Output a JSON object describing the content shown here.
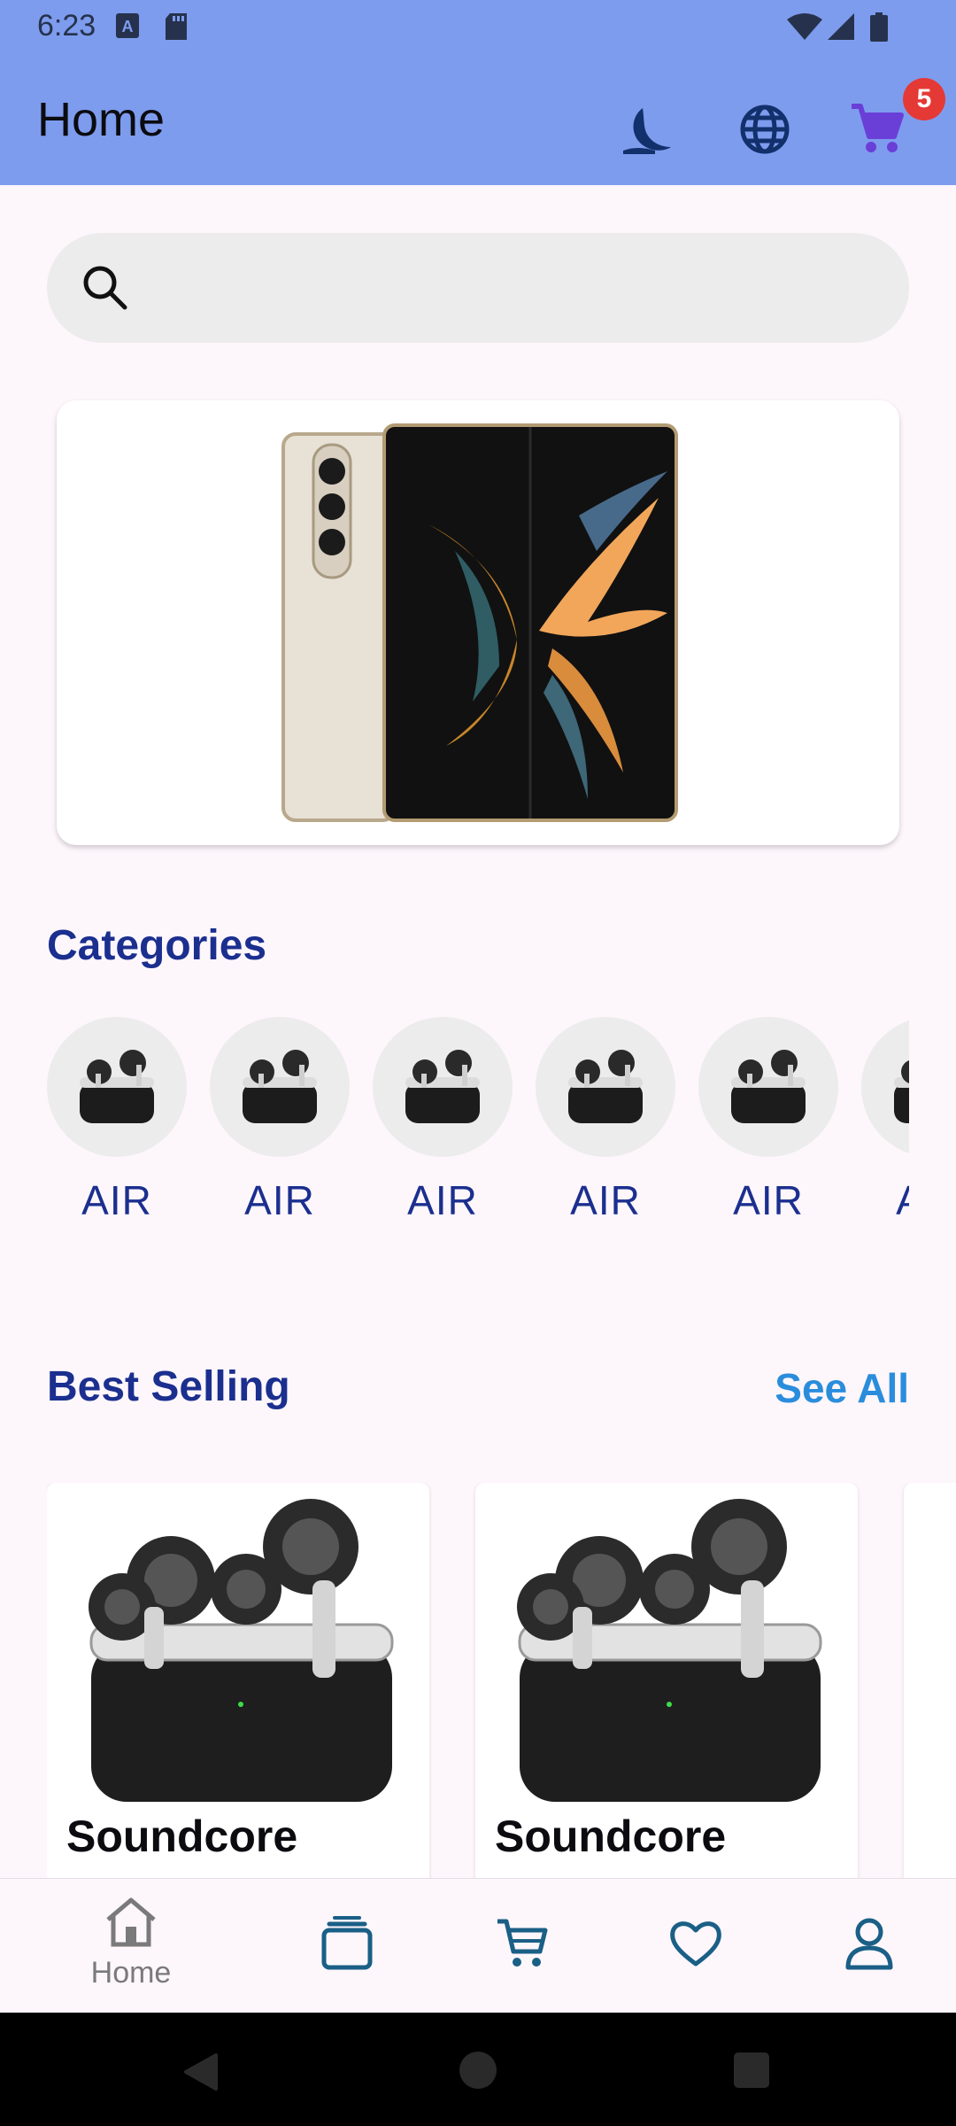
{
  "status_bar": {
    "time": "6:23",
    "left_icons": [
      "a-notification-icon",
      "sd-card-icon"
    ],
    "right_icons": [
      "wifi-icon",
      "cell-signal-icon",
      "battery-icon"
    ]
  },
  "app_bar": {
    "title": "Home",
    "icons": [
      "dark-mode-icon",
      "language-icon",
      "cart-icon"
    ],
    "cart_badge": "5",
    "background": "#7e9cee"
  },
  "search": {
    "placeholder": "",
    "value": ""
  },
  "banner": {
    "image": "foldable-phone-image"
  },
  "categories": {
    "title": "Categories",
    "items": [
      {
        "label": "AIR"
      },
      {
        "label": "AIR"
      },
      {
        "label": "AIR"
      },
      {
        "label": "AIR"
      },
      {
        "label": "AIR"
      },
      {
        "label": "AIR"
      }
    ]
  },
  "best_selling": {
    "title": "Best Selling",
    "see_all": "See All",
    "products": [
      {
        "name": "Soundcore"
      },
      {
        "name": "Soundcore"
      }
    ]
  },
  "bottom_nav": {
    "items": [
      {
        "label": "Home",
        "icon": "home-icon"
      },
      {
        "label": "",
        "icon": "categories-icon"
      },
      {
        "label": "",
        "icon": "cart-icon"
      },
      {
        "label": "",
        "icon": "heart-icon"
      },
      {
        "label": "",
        "icon": "profile-icon"
      }
    ]
  },
  "colors": {
    "accent": "#1b2f8f",
    "link": "#2a8ddc",
    "badge": "#e53935",
    "nav_icon": "#1a5f86"
  }
}
